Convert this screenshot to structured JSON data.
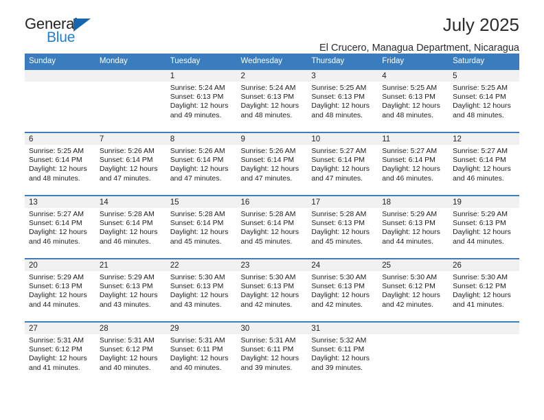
{
  "logo": {
    "name_top": "General",
    "name_bottom": "Blue",
    "triangle_icon": "triangle-icon",
    "color_dark": "#232323",
    "color_blue": "#1f7fd4"
  },
  "header": {
    "title": "July 2025",
    "subtitle": "El Crucero, Managua Department, Nicaragua"
  },
  "colors": {
    "header_row": "#3a7dbf",
    "daynum_band": "#f1f1f1",
    "text": "#1c1c1c"
  },
  "weekday_headers": [
    "Sunday",
    "Monday",
    "Tuesday",
    "Wednesday",
    "Thursday",
    "Friday",
    "Saturday"
  ],
  "weeks": [
    [
      {
        "day": "",
        "sunrise": "",
        "sunset": "",
        "daylight": ""
      },
      {
        "day": "",
        "sunrise": "",
        "sunset": "",
        "daylight": ""
      },
      {
        "day": "1",
        "sunrise": "Sunrise: 5:24 AM",
        "sunset": "Sunset: 6:13 PM",
        "daylight": "Daylight: 12 hours and 49 minutes."
      },
      {
        "day": "2",
        "sunrise": "Sunrise: 5:24 AM",
        "sunset": "Sunset: 6:13 PM",
        "daylight": "Daylight: 12 hours and 48 minutes."
      },
      {
        "day": "3",
        "sunrise": "Sunrise: 5:25 AM",
        "sunset": "Sunset: 6:13 PM",
        "daylight": "Daylight: 12 hours and 48 minutes."
      },
      {
        "day": "4",
        "sunrise": "Sunrise: 5:25 AM",
        "sunset": "Sunset: 6:13 PM",
        "daylight": "Daylight: 12 hours and 48 minutes."
      },
      {
        "day": "5",
        "sunrise": "Sunrise: 5:25 AM",
        "sunset": "Sunset: 6:14 PM",
        "daylight": "Daylight: 12 hours and 48 minutes."
      }
    ],
    [
      {
        "day": "6",
        "sunrise": "Sunrise: 5:25 AM",
        "sunset": "Sunset: 6:14 PM",
        "daylight": "Daylight: 12 hours and 48 minutes."
      },
      {
        "day": "7",
        "sunrise": "Sunrise: 5:26 AM",
        "sunset": "Sunset: 6:14 PM",
        "daylight": "Daylight: 12 hours and 47 minutes."
      },
      {
        "day": "8",
        "sunrise": "Sunrise: 5:26 AM",
        "sunset": "Sunset: 6:14 PM",
        "daylight": "Daylight: 12 hours and 47 minutes."
      },
      {
        "day": "9",
        "sunrise": "Sunrise: 5:26 AM",
        "sunset": "Sunset: 6:14 PM",
        "daylight": "Daylight: 12 hours and 47 minutes."
      },
      {
        "day": "10",
        "sunrise": "Sunrise: 5:27 AM",
        "sunset": "Sunset: 6:14 PM",
        "daylight": "Daylight: 12 hours and 47 minutes."
      },
      {
        "day": "11",
        "sunrise": "Sunrise: 5:27 AM",
        "sunset": "Sunset: 6:14 PM",
        "daylight": "Daylight: 12 hours and 46 minutes."
      },
      {
        "day": "12",
        "sunrise": "Sunrise: 5:27 AM",
        "sunset": "Sunset: 6:14 PM",
        "daylight": "Daylight: 12 hours and 46 minutes."
      }
    ],
    [
      {
        "day": "13",
        "sunrise": "Sunrise: 5:27 AM",
        "sunset": "Sunset: 6:14 PM",
        "daylight": "Daylight: 12 hours and 46 minutes."
      },
      {
        "day": "14",
        "sunrise": "Sunrise: 5:28 AM",
        "sunset": "Sunset: 6:14 PM",
        "daylight": "Daylight: 12 hours and 46 minutes."
      },
      {
        "day": "15",
        "sunrise": "Sunrise: 5:28 AM",
        "sunset": "Sunset: 6:14 PM",
        "daylight": "Daylight: 12 hours and 45 minutes."
      },
      {
        "day": "16",
        "sunrise": "Sunrise: 5:28 AM",
        "sunset": "Sunset: 6:14 PM",
        "daylight": "Daylight: 12 hours and 45 minutes."
      },
      {
        "day": "17",
        "sunrise": "Sunrise: 5:28 AM",
        "sunset": "Sunset: 6:13 PM",
        "daylight": "Daylight: 12 hours and 45 minutes."
      },
      {
        "day": "18",
        "sunrise": "Sunrise: 5:29 AM",
        "sunset": "Sunset: 6:13 PM",
        "daylight": "Daylight: 12 hours and 44 minutes."
      },
      {
        "day": "19",
        "sunrise": "Sunrise: 5:29 AM",
        "sunset": "Sunset: 6:13 PM",
        "daylight": "Daylight: 12 hours and 44 minutes."
      }
    ],
    [
      {
        "day": "20",
        "sunrise": "Sunrise: 5:29 AM",
        "sunset": "Sunset: 6:13 PM",
        "daylight": "Daylight: 12 hours and 44 minutes."
      },
      {
        "day": "21",
        "sunrise": "Sunrise: 5:29 AM",
        "sunset": "Sunset: 6:13 PM",
        "daylight": "Daylight: 12 hours and 43 minutes."
      },
      {
        "day": "22",
        "sunrise": "Sunrise: 5:30 AM",
        "sunset": "Sunset: 6:13 PM",
        "daylight": "Daylight: 12 hours and 43 minutes."
      },
      {
        "day": "23",
        "sunrise": "Sunrise: 5:30 AM",
        "sunset": "Sunset: 6:13 PM",
        "daylight": "Daylight: 12 hours and 42 minutes."
      },
      {
        "day": "24",
        "sunrise": "Sunrise: 5:30 AM",
        "sunset": "Sunset: 6:13 PM",
        "daylight": "Daylight: 12 hours and 42 minutes."
      },
      {
        "day": "25",
        "sunrise": "Sunrise: 5:30 AM",
        "sunset": "Sunset: 6:12 PM",
        "daylight": "Daylight: 12 hours and 42 minutes."
      },
      {
        "day": "26",
        "sunrise": "Sunrise: 5:30 AM",
        "sunset": "Sunset: 6:12 PM",
        "daylight": "Daylight: 12 hours and 41 minutes."
      }
    ],
    [
      {
        "day": "27",
        "sunrise": "Sunrise: 5:31 AM",
        "sunset": "Sunset: 6:12 PM",
        "daylight": "Daylight: 12 hours and 41 minutes."
      },
      {
        "day": "28",
        "sunrise": "Sunrise: 5:31 AM",
        "sunset": "Sunset: 6:12 PM",
        "daylight": "Daylight: 12 hours and 40 minutes."
      },
      {
        "day": "29",
        "sunrise": "Sunrise: 5:31 AM",
        "sunset": "Sunset: 6:11 PM",
        "daylight": "Daylight: 12 hours and 40 minutes."
      },
      {
        "day": "30",
        "sunrise": "Sunrise: 5:31 AM",
        "sunset": "Sunset: 6:11 PM",
        "daylight": "Daylight: 12 hours and 39 minutes."
      },
      {
        "day": "31",
        "sunrise": "Sunrise: 5:32 AM",
        "sunset": "Sunset: 6:11 PM",
        "daylight": "Daylight: 12 hours and 39 minutes."
      },
      {
        "day": "",
        "sunrise": "",
        "sunset": "",
        "daylight": ""
      },
      {
        "day": "",
        "sunrise": "",
        "sunset": "",
        "daylight": ""
      }
    ]
  ]
}
